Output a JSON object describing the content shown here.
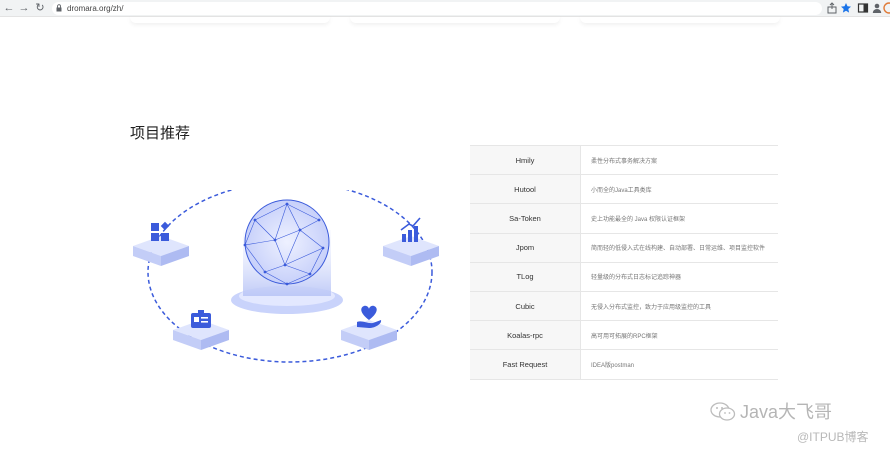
{
  "browser": {
    "url": "dromara.org/zh/",
    "back": "←",
    "forward": "→",
    "reload": "↻"
  },
  "section": {
    "title": "项目推荐"
  },
  "projects": [
    {
      "name": "Hmily",
      "desc": "柔性分布式事务解决方案"
    },
    {
      "name": "Hutool",
      "desc": "小而全的Java工具类库"
    },
    {
      "name": "Sa-Token",
      "desc": "史上功能最全的 Java 权限认证框架"
    },
    {
      "name": "Jpom",
      "desc": "简而轻的低侵入式在线构建、自动部署、日常运维、项目监控软件"
    },
    {
      "name": "TLog",
      "desc": "轻量级的分布式日志标记追踪神器"
    },
    {
      "name": "Cubic",
      "desc": "无侵入分布式监控，致力于应用级监控的工具"
    },
    {
      "name": "Koalas-rpc",
      "desc": "高可用可拓展的RPC框架"
    },
    {
      "name": "Fast Request",
      "desc": "IDEA版postman"
    }
  ],
  "watermark": {
    "line1": "Java大飞哥",
    "line2": "@ITPUB博客"
  },
  "colors": {
    "accent": "#3b5bdb",
    "platform": "#c9d3fb"
  }
}
